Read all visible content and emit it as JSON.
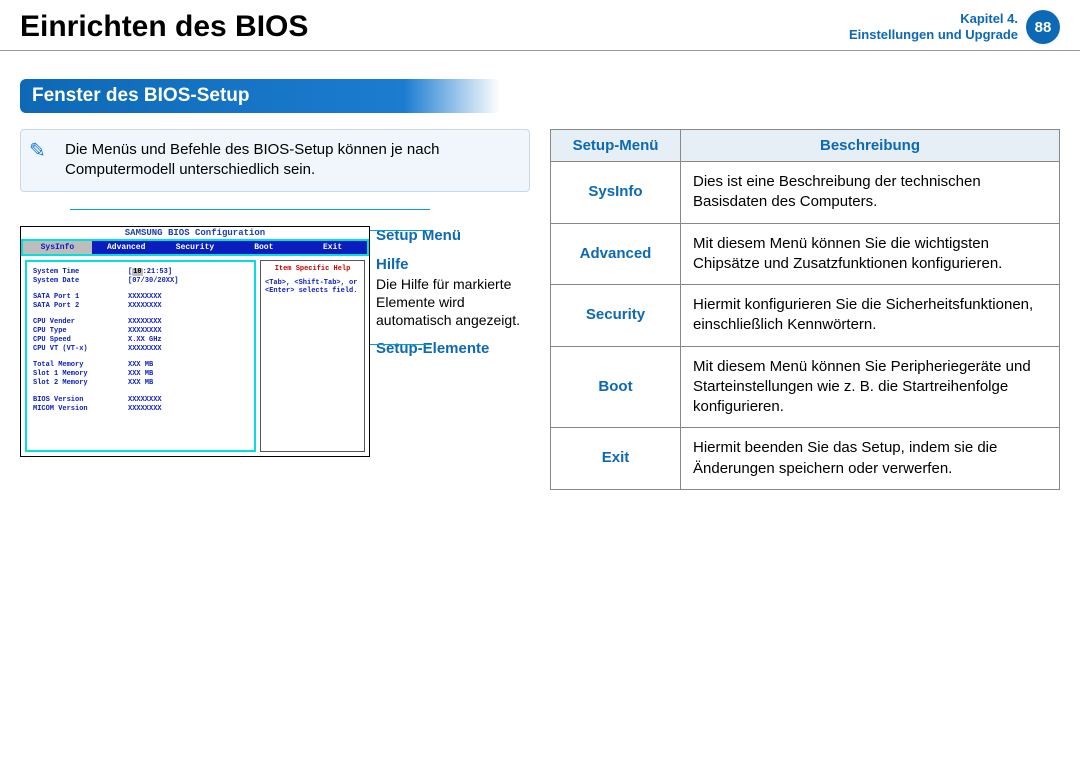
{
  "header": {
    "title": "Einrichten des BIOS",
    "chapter_line1": "Kapitel 4.",
    "chapter_line2": "Einstellungen und Upgrade",
    "page": "88"
  },
  "section_heading": "Fenster des BIOS-Setup",
  "note": "Die Menüs und Befehle des BIOS-Setup können je nach Computermodell unterschiedlich sein.",
  "callouts": {
    "setup_menu": "Setup Menü",
    "help": "Hilfe",
    "help_desc": "Die Hilfe für markierte Elemente wird automatisch angezeigt.",
    "setup_elements": "Setup-Elemente"
  },
  "bios": {
    "title": "SAMSUNG BIOS Configuration",
    "tabs": [
      "SysInfo",
      "Advanced",
      "Security",
      "Boot",
      "Exit"
    ],
    "help_title": "Item Specific Help",
    "help_text": "<Tab>, <Shift-Tab>, or <Enter> selects field.",
    "rows1": [
      {
        "label": "System Time",
        "val": "[10:21:53]"
      },
      {
        "label": "System Date",
        "val": "[07/30/20XX]"
      }
    ],
    "rows2": [
      {
        "label": "SATA Port 1",
        "val": "XXXXXXXX"
      },
      {
        "label": "SATA Port 2",
        "val": "XXXXXXXX"
      }
    ],
    "rows3": [
      {
        "label": "CPU Vender",
        "val": "XXXXXXXX"
      },
      {
        "label": "CPU Type",
        "val": "XXXXXXXX"
      },
      {
        "label": "CPU Speed",
        "val": "X.XX GHz"
      },
      {
        "label": "CPU VT (VT-x)",
        "val": "XXXXXXXX"
      }
    ],
    "rows4": [
      {
        "label": "Total Memory",
        "val": "XXX MB"
      },
      {
        "label": " Slot 1 Memory",
        "val": "XXX MB"
      },
      {
        "label": " Slot 2 Memory",
        "val": "XXX MB"
      }
    ],
    "rows5": [
      {
        "label": "BIOS Version",
        "val": "XXXXXXXX"
      },
      {
        "label": "MICOM Version",
        "val": "XXXXXXXX"
      }
    ]
  },
  "table": {
    "head_menu": "Setup-Menü",
    "head_desc": "Beschreibung",
    "rows": [
      {
        "menu": "SysInfo",
        "desc": "Dies ist eine Beschreibung der technischen Basisdaten des Computers."
      },
      {
        "menu": "Advanced",
        "desc": "Mit diesem Menü können Sie die wichtigsten Chipsätze und Zusatzfunktionen konfigurieren."
      },
      {
        "menu": "Security",
        "desc": "Hiermit konfigurieren Sie die Sicherheitsfunktionen, einschließlich Kennwörtern."
      },
      {
        "menu": "Boot",
        "desc": "Mit diesem Menü können Sie Peripheriegeräte und Starteinstellungen wie z. B. die Startreihenfolge konfigurieren."
      },
      {
        "menu": "Exit",
        "desc": "Hiermit beenden Sie das Setup, indem sie die Änderungen speichern oder verwerfen."
      }
    ]
  }
}
